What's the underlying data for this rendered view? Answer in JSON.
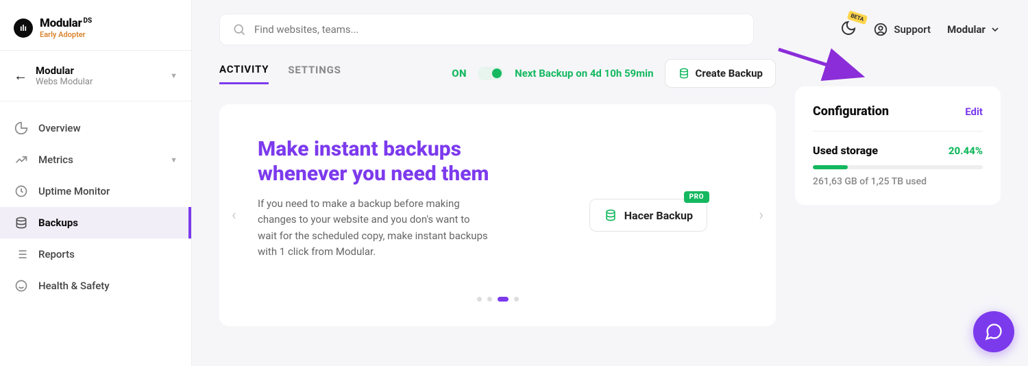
{
  "logo": {
    "name": "Modular",
    "ds": "DS",
    "tagline": "Early Adopter"
  },
  "site": {
    "name": "Modular",
    "sub": "Webs Modular"
  },
  "nav": {
    "overview": "Overview",
    "metrics": "Metrics",
    "uptime": "Uptime Monitor",
    "backups": "Backups",
    "reports": "Reports",
    "health": "Health & Safety"
  },
  "search": {
    "placeholder": "Find websites, teams..."
  },
  "topbar": {
    "beta": "BETA",
    "support": "Support",
    "user": "Modular"
  },
  "tabs": {
    "activity": "ACTIVITY",
    "settings": "SETTINGS"
  },
  "status": {
    "on": "ON",
    "next": "Next Backup on 4d 10h 59min"
  },
  "create_btn": "Create Backup",
  "hero": {
    "title": "Make instant backups whenever you need them",
    "desc": "If you need to make a backup before making changes to your website and you don's want to wait for the scheduled copy, make instant backups with 1 click from Modular.",
    "action": "Hacer Backup",
    "pro": "PRO"
  },
  "config": {
    "title": "Configuration",
    "edit": "Edit",
    "storage_label": "Used storage",
    "storage_pct": "20.44%",
    "storage_fill_width": "20.44%",
    "storage_used": "261,63 GB of 1,25 TB used"
  }
}
